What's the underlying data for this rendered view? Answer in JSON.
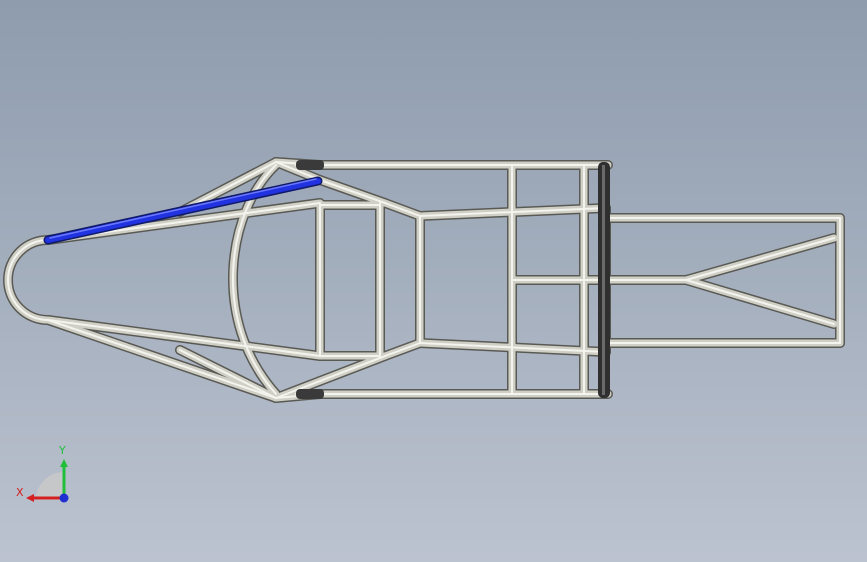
{
  "viewport": {
    "background_top": "#8e9cae",
    "background_bottom": "#bcc3d0"
  },
  "model": {
    "tube_color": "#d4d4cc",
    "tube_edge_color": "#555555",
    "selected_tube_color": "#1f2fd8",
    "dark_tube_color": "#3a3a3a"
  },
  "triad": {
    "x_label": "X",
    "y_label": "Y",
    "x_color": "#d42020",
    "y_color": "#1fbf3a",
    "z_color": "#2030d0"
  }
}
